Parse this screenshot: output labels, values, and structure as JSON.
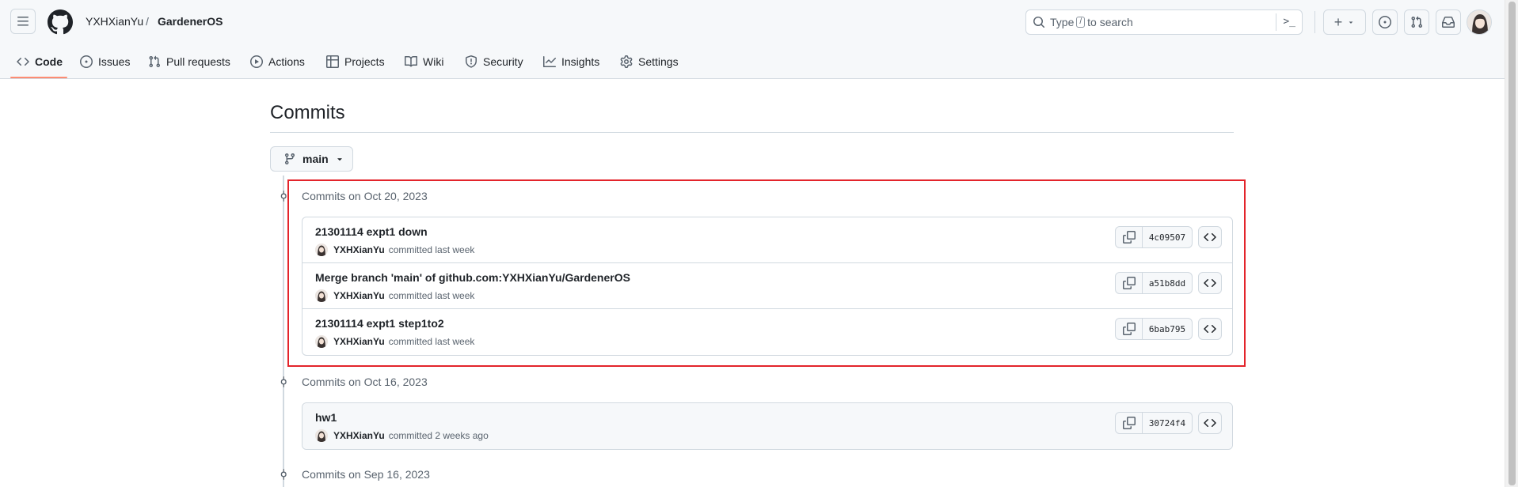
{
  "header": {
    "owner": "YXHXianYu",
    "separator": "/",
    "repo": "GardenerOS",
    "search_placeholder": "Type",
    "search_key": "/",
    "search_suffix": "to search",
    "plus_label": "+"
  },
  "tabs": [
    {
      "label": "Code",
      "icon": "code-icon",
      "active": true
    },
    {
      "label": "Issues",
      "icon": "issue-icon"
    },
    {
      "label": "Pull requests",
      "icon": "pull-request-icon"
    },
    {
      "label": "Actions",
      "icon": "play-icon"
    },
    {
      "label": "Projects",
      "icon": "table-icon"
    },
    {
      "label": "Wiki",
      "icon": "book-icon"
    },
    {
      "label": "Security",
      "icon": "shield-icon"
    },
    {
      "label": "Insights",
      "icon": "graph-icon"
    },
    {
      "label": "Settings",
      "icon": "gear-icon"
    }
  ],
  "page": {
    "title": "Commits",
    "branch": "main"
  },
  "groups": [
    {
      "heading": "Commits on Oct 20, 2023",
      "commits": [
        {
          "message": "21301114 expt1 down",
          "author": "YXHXianYu",
          "when": "committed last week",
          "sha": "4c09507"
        },
        {
          "message": "Merge branch 'main' of github.com:YXHXianYu/GardenerOS",
          "author": "YXHXianYu",
          "when": "committed last week",
          "sha": "a51b8dd"
        },
        {
          "message": "21301114 expt1 step1to2",
          "author": "YXHXianYu",
          "when": "committed last week",
          "sha": "6bab795"
        }
      ]
    },
    {
      "heading": "Commits on Oct 16, 2023",
      "commits": [
        {
          "message": "hw1",
          "author": "YXHXianYu",
          "when": "committed 2 weeks ago",
          "sha": "30724f4"
        }
      ]
    },
    {
      "heading": "Commits on Sep 16, 2023",
      "commits": []
    }
  ],
  "colors": {
    "accent_underline": "#fd8c73",
    "highlight_box": "#e3242b",
    "border": "#d1d9e0"
  }
}
